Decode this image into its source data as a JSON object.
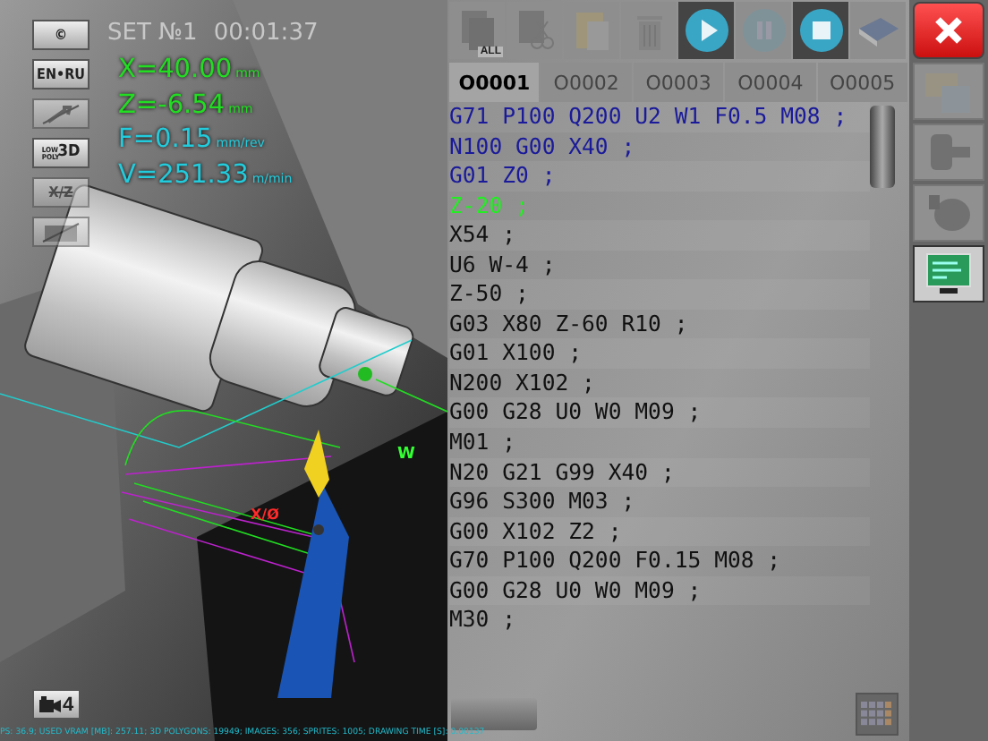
{
  "hud": {
    "set": "SET №1",
    "time": "00:01:37"
  },
  "side_buttons": [
    {
      "kind": "text",
      "label": "©",
      "disabled": false
    },
    {
      "kind": "text",
      "label": "EN•RU",
      "disabled": false
    },
    {
      "kind": "wrench",
      "disabled": true
    },
    {
      "kind": "lowpoly",
      "label_small": "LOW POLY",
      "label": "3D",
      "disabled": false
    },
    {
      "kind": "text",
      "label": "X/Z",
      "disabled": true
    },
    {
      "kind": "image",
      "disabled": true
    }
  ],
  "readouts": [
    {
      "value": "X=40.00",
      "unit": "mm",
      "color": "#22dd22"
    },
    {
      "value": "Z=-6.54",
      "unit": "mm",
      "color": "#22dd22"
    },
    {
      "value": "F=0.15",
      "unit": "mm/rev",
      "color": "#22ccdd"
    },
    {
      "value": "V=251.33",
      "unit": "m/min",
      "color": "#22ccdd"
    }
  ],
  "scene_labels": {
    "origin": "W",
    "axis": "X/Ø"
  },
  "camera_button": {
    "label": "4"
  },
  "status_bar": "PS: 36.9; USED VRAM [MB]: 257.11; 3D POLYGONS: 19949; IMAGES: 356; SPRITES: 1005; DRAWING TIME [S]: 0.00137",
  "toolbar": [
    {
      "kind": "copy-all",
      "label": "ALL",
      "disabled": true
    },
    {
      "kind": "cut",
      "disabled": true
    },
    {
      "kind": "paste",
      "disabled": true
    },
    {
      "kind": "delete",
      "disabled": true
    },
    {
      "kind": "play",
      "disabled": false
    },
    {
      "kind": "pause",
      "disabled": true
    },
    {
      "kind": "stop",
      "disabled": false
    },
    {
      "kind": "book",
      "disabled": true
    }
  ],
  "tabs": [
    {
      "label": "O0001",
      "selected": true
    },
    {
      "label": "O0002",
      "selected": false
    },
    {
      "label": "O0003",
      "selected": false
    },
    {
      "label": "O0004",
      "selected": false
    },
    {
      "label": "O0005",
      "selected": false
    }
  ],
  "code_lines": [
    {
      "text": "G71 P100 Q200 U2 W1 F0.5 M08 ;",
      "kind": "done"
    },
    {
      "text": "N100 G00 X40 ;",
      "kind": "done"
    },
    {
      "text": "G01 Z0 ;",
      "kind": "done"
    },
    {
      "text": "Z-20 ;",
      "kind": "current"
    },
    {
      "text": "X54 ;",
      "kind": "pending"
    },
    {
      "text": "U6 W-4 ;",
      "kind": "pending"
    },
    {
      "text": "Z-50 ;",
      "kind": "pending"
    },
    {
      "text": "G03 X80 Z-60 R10 ;",
      "kind": "pending"
    },
    {
      "text": "G01 X100 ;",
      "kind": "pending"
    },
    {
      "text": "N200 X102 ;",
      "kind": "pending"
    },
    {
      "text": "G00 G28 U0 W0 M09 ;",
      "kind": "pending"
    },
    {
      "text": "M01 ;",
      "kind": "pending"
    },
    {
      "text": "N20 G21 G99 X40 ;",
      "kind": "pending"
    },
    {
      "text": "G96 S300 M03 ;",
      "kind": "pending"
    },
    {
      "text": "G00 X102 Z2 ;",
      "kind": "pending"
    },
    {
      "text": "G70 P100 Q200 F0.15 M08 ;",
      "kind": "pending"
    },
    {
      "text": "G00 G28 U0 W0 M09 ;",
      "kind": "pending"
    },
    {
      "text": "M30 ;",
      "kind": "pending"
    }
  ],
  "right_tools": [
    {
      "kind": "save",
      "disabled": true
    },
    {
      "kind": "chuck",
      "disabled": true
    },
    {
      "kind": "tool",
      "disabled": true
    },
    {
      "kind": "monitor",
      "disabled": false,
      "selected": true
    }
  ]
}
